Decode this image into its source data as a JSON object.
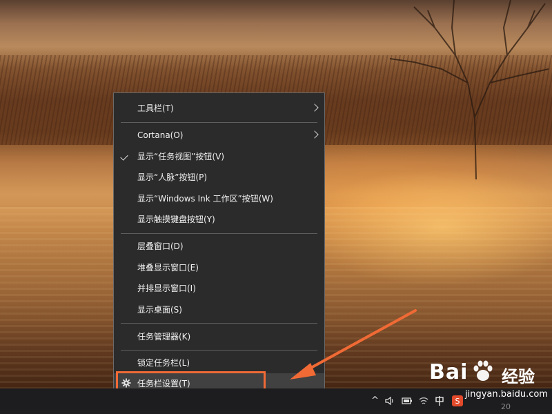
{
  "menu": {
    "items": [
      {
        "label": "工具栏(T)",
        "submenu": true
      },
      {
        "label": "Cortana(O)",
        "submenu": true
      },
      {
        "label": "显示“任务视图”按钮(V)",
        "checked": true
      },
      {
        "label": "显示“人脉”按钮(P)"
      },
      {
        "label": "显示“Windows Ink 工作区”按钮(W)"
      },
      {
        "label": "显示触摸键盘按钮(Y)"
      },
      {
        "label": "层叠窗口(D)"
      },
      {
        "label": "堆叠显示窗口(E)"
      },
      {
        "label": "并排显示窗口(I)"
      },
      {
        "label": "显示桌面(S)"
      },
      {
        "label": "任务管理器(K)"
      },
      {
        "label": "锁定任务栏(L)"
      },
      {
        "label": "任务栏设置(T)",
        "highlighted": true,
        "icon": "gear-icon"
      }
    ]
  },
  "taskbar": {
    "tray_icons": [
      "chevron-up-icon",
      "speaker-icon",
      "battery-icon",
      "wifi-icon",
      "ime-icon",
      "sogou-icon"
    ],
    "clock_partial": "20"
  },
  "annotation": {
    "color": "#f06a35"
  },
  "watermark": {
    "brand": "Bai",
    "brand_cn": "经验",
    "url": "jingyan.baidu.com"
  }
}
